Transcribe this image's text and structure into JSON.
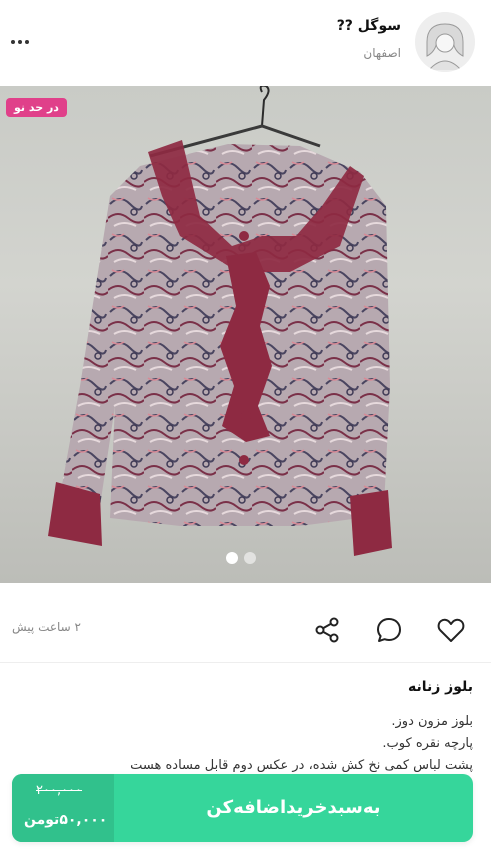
{
  "seller": {
    "name": "سوگل ??",
    "city": "اصفهان"
  },
  "badge": {
    "label": "در حد نو"
  },
  "carousel": {
    "count": 2,
    "active_index": 0
  },
  "post": {
    "time_ago": "۲ ساعت پیش"
  },
  "product": {
    "title": "بلوز زنانه",
    "description_lines": [
      "بلوز مزون دوز.",
      "پارچه نقره کوب.",
      "پشت لباس کمی نخ کش شده، در عکس دوم قابل مساده هست"
    ]
  },
  "cart": {
    "old_price": "۲۰۰,۰۰۰",
    "new_price": "۵۰,۰۰۰تومن",
    "button_label": "به‌سبدخریداضافه‌کن"
  },
  "colors": {
    "primary_green": "#36d69b",
    "badge_pink": "#e0408a",
    "blouse_burgundy": "#8e2a42"
  }
}
